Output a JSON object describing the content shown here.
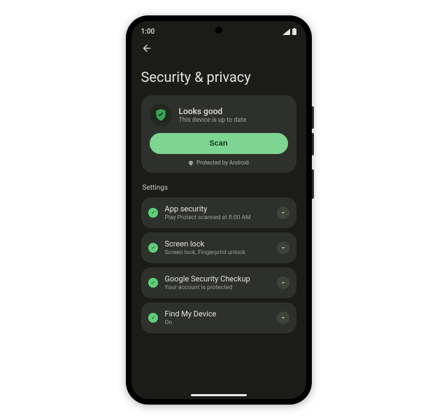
{
  "status_bar": {
    "time": "1:00"
  },
  "page": {
    "title": "Security & privacy"
  },
  "status_card": {
    "title": "Looks good",
    "subtitle": "This device is up to date",
    "scan_label": "Scan",
    "protected_label": "Protected by Android"
  },
  "section_label": "Settings",
  "settings": [
    {
      "title": "App security",
      "subtitle": "Play Protect scanned at 8:00 AM"
    },
    {
      "title": "Screen lock",
      "subtitle": "Screen lock, Fingerprint unlock"
    },
    {
      "title": "Google Security Checkup",
      "subtitle": "Your account is protected"
    },
    {
      "title": "Find My Device",
      "subtitle": "On"
    }
  ],
  "colors": {
    "accent": "#7ed491",
    "bg": "#1b1c18",
    "card": "#2e312b"
  }
}
